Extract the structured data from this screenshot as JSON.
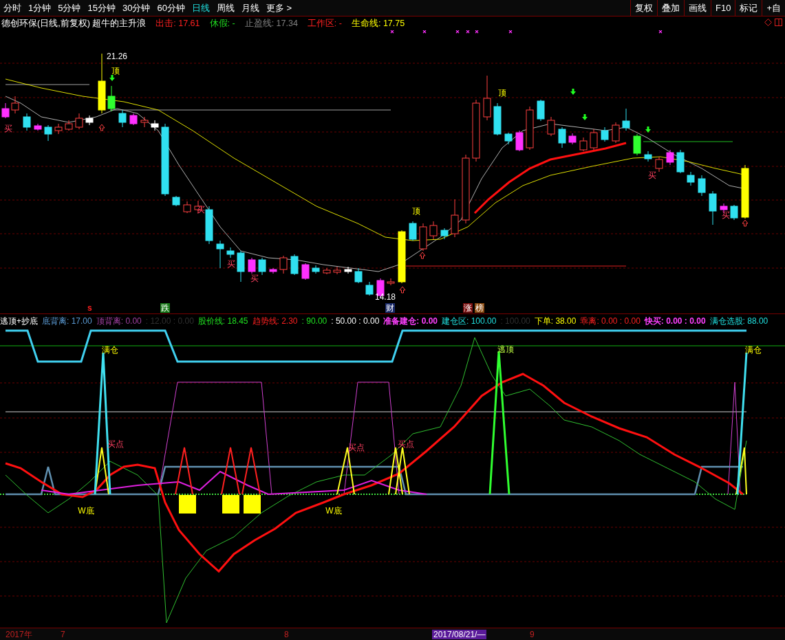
{
  "toolbar": {
    "periods": [
      {
        "label": "分时",
        "selected": false
      },
      {
        "label": "1分钟",
        "selected": false
      },
      {
        "label": "5分钟",
        "selected": false
      },
      {
        "label": "15分钟",
        "selected": false
      },
      {
        "label": "30分钟",
        "selected": false
      },
      {
        "label": "60分钟",
        "selected": false
      },
      {
        "label": "日线",
        "selected": true
      },
      {
        "label": "周线",
        "selected": false
      },
      {
        "label": "月线",
        "selected": false
      },
      {
        "label": "更多 >",
        "selected": false
      }
    ],
    "buttons": [
      "复权",
      "叠加",
      "画线",
      "F10",
      "标记",
      "+自"
    ]
  },
  "main_chart": {
    "legend": [
      {
        "text": "德创环保(日线,前复权) 超牛的主升浪",
        "color": "#ffffff"
      },
      {
        "text": "出击: 17.61",
        "color": "#ff2020"
      },
      {
        "text": "休假: -",
        "color": "#20e020"
      },
      {
        "text": "止盈线: 17.34",
        "color": "#808080"
      },
      {
        "text": "工作区: -",
        "color": "#ff2020"
      },
      {
        "text": "生命线: 17.75",
        "color": "#ffff00"
      }
    ],
    "labels": [
      {
        "kind": "high",
        "text": "21.26"
      },
      {
        "kind": "low",
        "text": "14.18"
      },
      {
        "kind": "top",
        "text": "顶"
      },
      {
        "kind": "top",
        "text": "顶"
      },
      {
        "kind": "top",
        "text": "顶"
      },
      {
        "kind": "buy",
        "text": "买"
      },
      {
        "kind": "buy",
        "text": "买"
      },
      {
        "kind": "buy",
        "text": "买"
      },
      {
        "kind": "buy",
        "text": "买"
      },
      {
        "kind": "buy",
        "text": "买"
      },
      {
        "kind": "buy",
        "text": "买"
      }
    ]
  },
  "signal_row": [
    {
      "text": "s",
      "color": "#ff2020"
    },
    {
      "text": "跌",
      "color": "#1a7a1a"
    },
    {
      "text": "财",
      "color": "#1a2a6a"
    },
    {
      "text": "涨",
      "color": "#7a1010"
    },
    {
      "text": "榜",
      "color": "#8a4a10"
    }
  ],
  "indicator": {
    "legend": [
      {
        "text": "逃顶+抄底",
        "color": "#ffffff"
      },
      {
        "text": "底背离: 17.00",
        "color": "#5b9bd5"
      },
      {
        "text": "顶背离: 0.00",
        "color": "#a040a0"
      },
      {
        "text": ": 12.00 : 0.00",
        "color": "#303030"
      },
      {
        "text": "股价线: 18.45",
        "color": "#20e020"
      },
      {
        "text": "趋势线: 2.30",
        "color": "#ff2020"
      },
      {
        "text": ": 90.00",
        "color": "#20e020"
      },
      {
        "text": ": 50.00 : 0.00",
        "color": "#ffffff"
      },
      {
        "text": "准备建仓: 0.00",
        "color": "#ff40ff"
      },
      {
        "text": "建仓区: 100.00",
        "color": "#20e0e0"
      },
      {
        "text": ": 100.00",
        "color": "#303030"
      },
      {
        "text": "下单: 38.00",
        "color": "#ffff00"
      },
      {
        "text": "乖离: 0.00 : 0.00",
        "color": "#ff2020"
      },
      {
        "text": "快买: 0.00 : 0.00",
        "color": "#ff40ff"
      },
      {
        "text": "满仓选股: 88.00",
        "color": "#20e0e0"
      }
    ],
    "labels": [
      {
        "kind": "full",
        "text": "满仓"
      },
      {
        "kind": "escape",
        "text": "逃顶"
      },
      {
        "kind": "full",
        "text": "满仓"
      },
      {
        "kind": "buy",
        "text": "买点"
      },
      {
        "kind": "buy",
        "text": "买点"
      },
      {
        "kind": "buy",
        "text": "买点"
      },
      {
        "kind": "bottom",
        "text": "W底"
      },
      {
        "kind": "bottom",
        "text": "W底"
      }
    ]
  },
  "time_axis": [
    {
      "kind": "year",
      "text": "2017年"
    },
    {
      "kind": "month",
      "text": "7"
    },
    {
      "kind": "month",
      "text": "8"
    },
    {
      "kind": "cursor",
      "text": "2017/08/21/—"
    },
    {
      "kind": "month",
      "text": "9"
    }
  ]
}
